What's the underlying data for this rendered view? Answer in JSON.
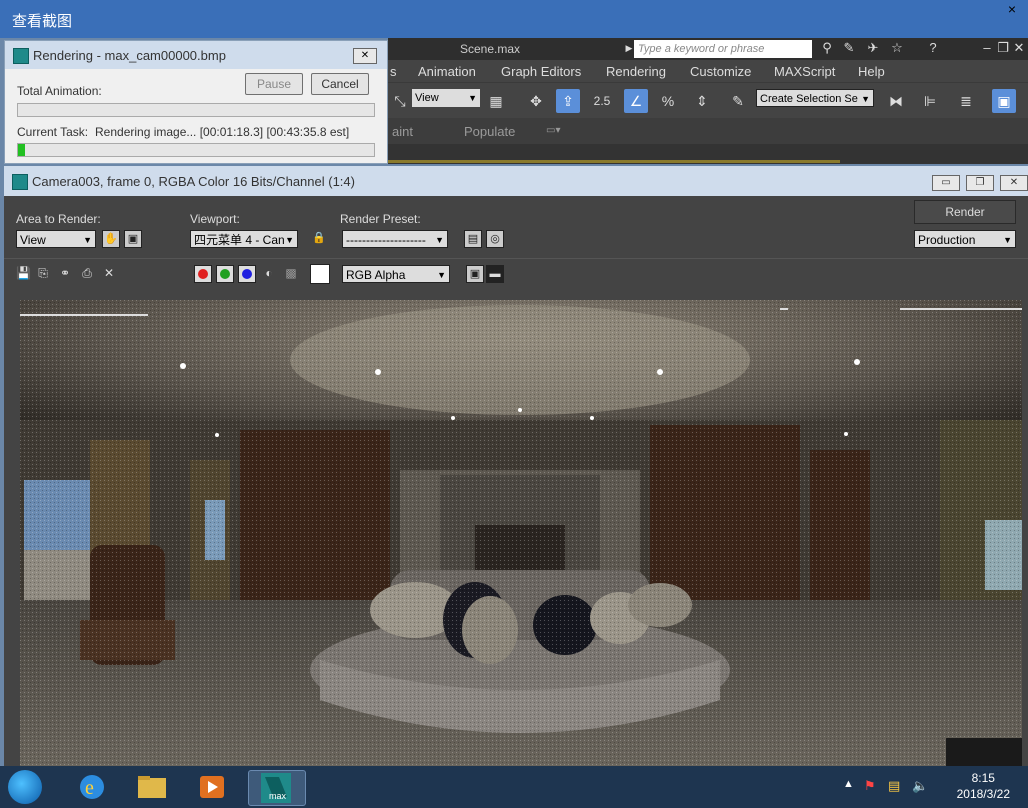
{
  "viewer": {
    "title": "查看截图",
    "close": "×"
  },
  "max": {
    "scene_title": "Scene.max",
    "search_placeholder": "Type a keyword or phrase",
    "menus": [
      "s",
      "Animation",
      "Graph Editors",
      "Rendering",
      "Customize",
      "MAXScript",
      "Help"
    ],
    "toolbar": {
      "view_dropdown": "View",
      "selection_set": "Create Selection Se",
      "snap_value": "2.5"
    },
    "ribbon": [
      "aint",
      "Populate"
    ]
  },
  "rendering_dialog": {
    "title": "Rendering - max_cam00000.bmp",
    "pause_label": "Pause",
    "cancel_label": "Cancel",
    "total_label": "Total Animation:",
    "total_progress": 0,
    "task_label": "Current Task:",
    "task_text": "Rendering image... [00:01:18.3] [00:43:35.8 est]",
    "task_progress": 0.02
  },
  "frame_buffer": {
    "title": "Camera003, frame 0, RGBA Color 16 Bits/Channel (1:4)",
    "area_label": "Area to Render:",
    "area_value": "View",
    "viewport_label": "Viewport:",
    "viewport_value": "四元菜单 4 - Can",
    "preset_label": "Render Preset:",
    "preset_value": "--------------------",
    "render_label": "Render",
    "production_value": "Production",
    "channel_value": "RGB Alpha",
    "channel_colors": {
      "red": "#e02020",
      "green": "#20a020",
      "blue": "#2020e0"
    }
  },
  "taskbar": {
    "time": "8:15",
    "date": "2018/3/22",
    "max_label": "max"
  }
}
